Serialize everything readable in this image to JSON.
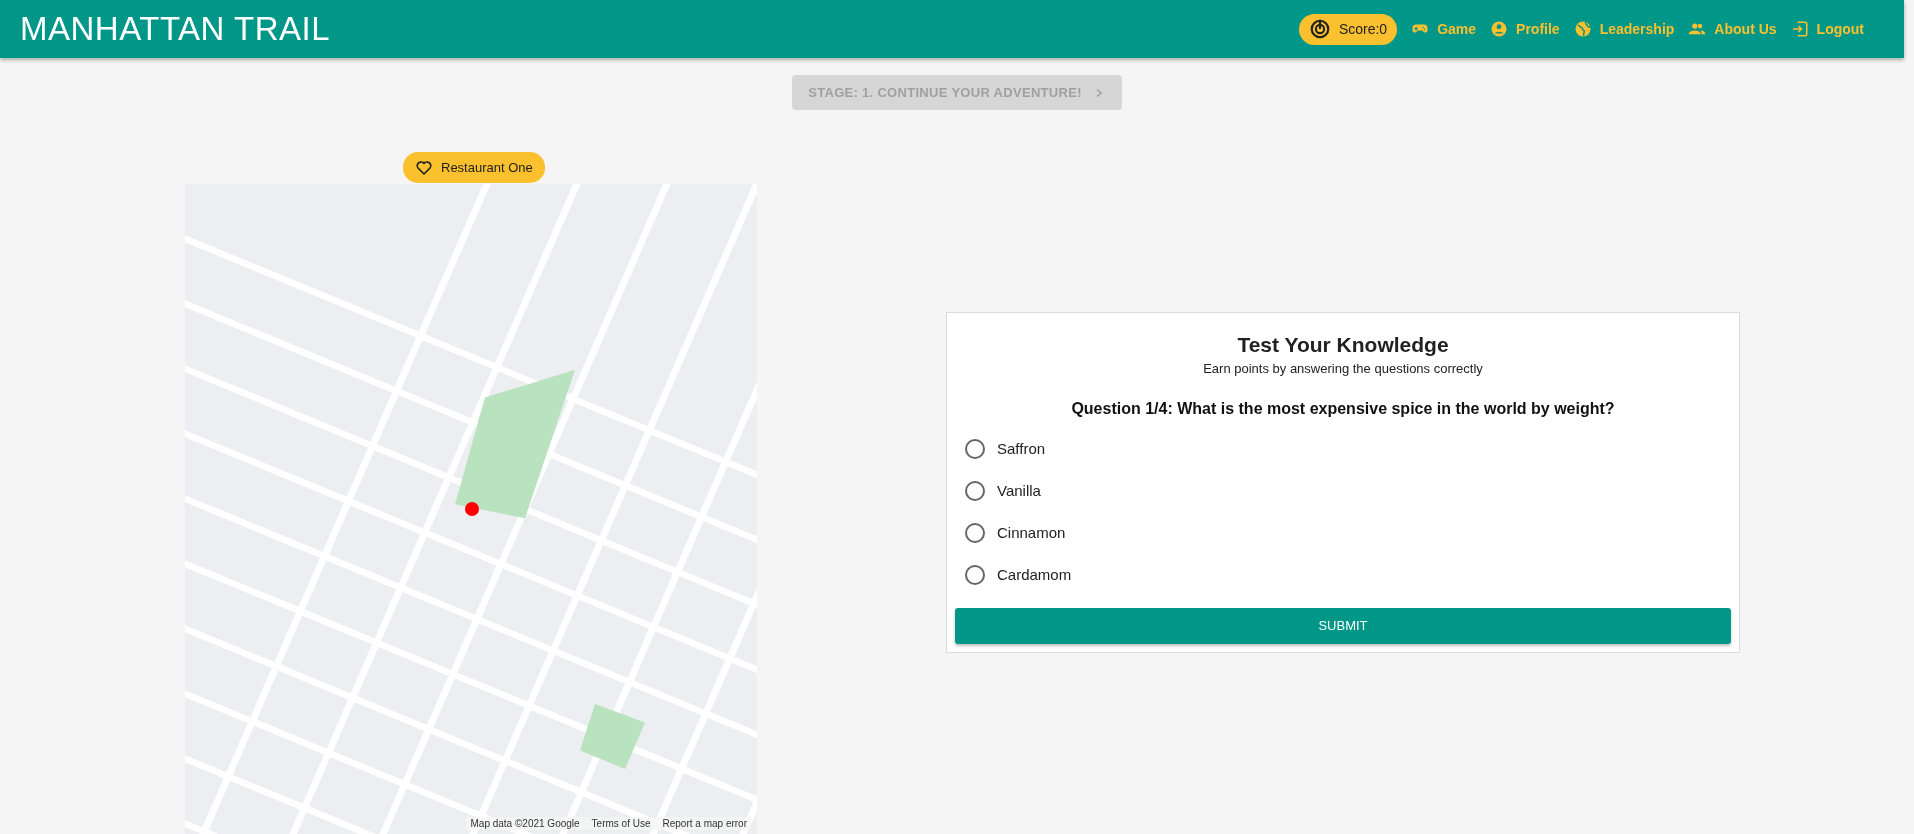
{
  "app_title": "MANHATTAN TRAIL",
  "score": "Score:0",
  "nav": [
    {
      "label": "Game",
      "kind": "gamepad"
    },
    {
      "label": "Profile",
      "kind": "profile"
    },
    {
      "label": "Leadership",
      "kind": "globe"
    },
    {
      "label": "About Us",
      "kind": "people"
    },
    {
      "label": "Logout",
      "kind": "logout"
    }
  ],
  "stage_button": {
    "label": "STAGE: 1. CONTINUE YOUR ADVENTURE!",
    "disabled": true
  },
  "map": {
    "place_badge": "Restaurant One",
    "attribution": [
      "Map data ©2021 Google",
      "Terms of Use",
      "Report a map error"
    ]
  },
  "quiz": {
    "title": "Test Your Knowledge",
    "subtitle": "Earn points by answering the questions correctly",
    "question": "Question 1/4: What is the most expensive spice in the world by weight?",
    "options": [
      {
        "label": "Saffron",
        "selected": false
      },
      {
        "label": "Vanilla",
        "selected": false
      },
      {
        "label": "Cinnamon",
        "selected": false
      },
      {
        "label": "Cardamom",
        "selected": false
      }
    ],
    "submit": "SUBMIT"
  }
}
